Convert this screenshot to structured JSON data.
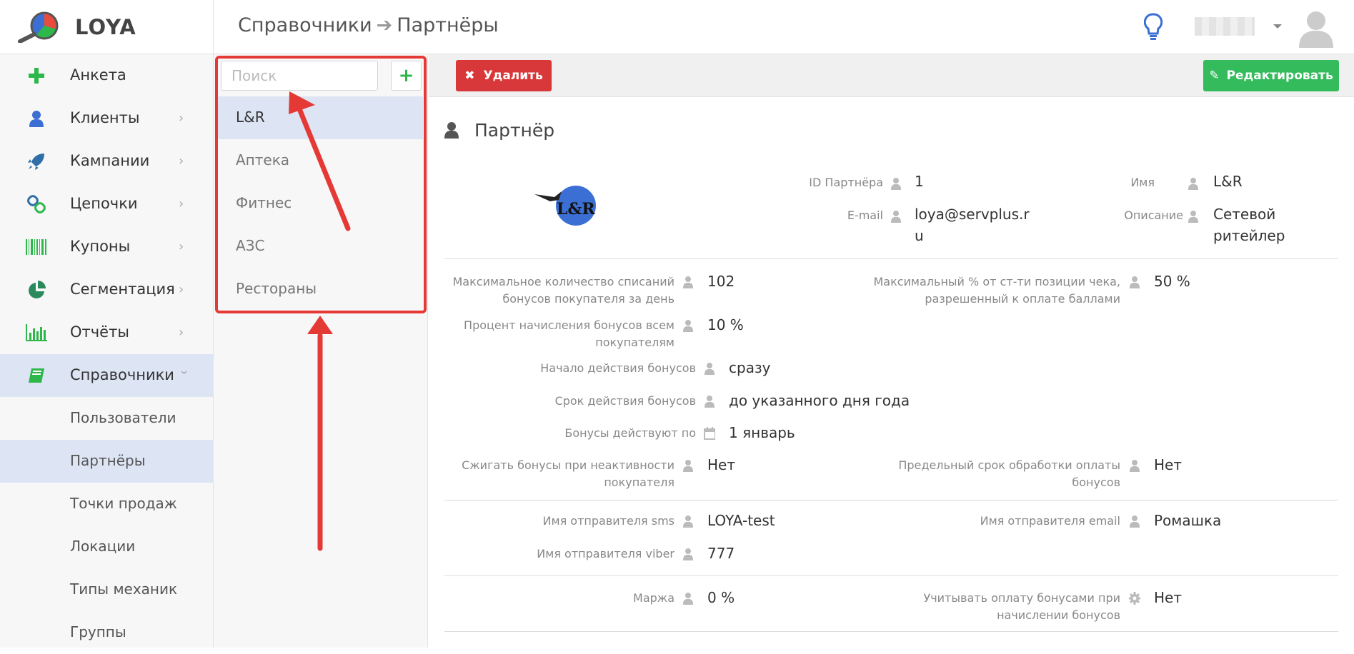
{
  "app": {
    "name": "LOYA"
  },
  "breadcrumb": {
    "parent": "Справочники",
    "arrow": "➔",
    "current": "Партнёры"
  },
  "sidebar": {
    "items": [
      {
        "label": "Анкета",
        "icon": "plus-icon",
        "chevron": ""
      },
      {
        "label": "Клиенты",
        "icon": "user-icon",
        "chevron": "›"
      },
      {
        "label": "Кампании",
        "icon": "rocket-icon",
        "chevron": "›"
      },
      {
        "label": "Цепочки",
        "icon": "chain-icon",
        "chevron": "›"
      },
      {
        "label": "Купоны",
        "icon": "barcode-icon",
        "chevron": "›"
      },
      {
        "label": "Сегментация",
        "icon": "pie-chart-icon",
        "chevron": "›"
      },
      {
        "label": "Отчёты",
        "icon": "bar-chart-icon",
        "chevron": "›"
      },
      {
        "label": "Справочники",
        "icon": "book-icon",
        "chevron": "⌄"
      }
    ],
    "subitems": [
      {
        "label": "Пользователи"
      },
      {
        "label": "Партнёры"
      },
      {
        "label": "Точки продаж"
      },
      {
        "label": "Локации"
      },
      {
        "label": "Типы механик"
      },
      {
        "label": "Группы"
      }
    ]
  },
  "partners_list": {
    "search_placeholder": "Поиск",
    "add_label": "+",
    "items": [
      {
        "label": "L&R"
      },
      {
        "label": "Аптека"
      },
      {
        "label": "Фитнес"
      },
      {
        "label": "АЗС"
      },
      {
        "label": "Рестораны"
      }
    ]
  },
  "toolbar": {
    "delete_label": "Удалить",
    "delete_icon": "✖",
    "edit_label": "Редактировать",
    "edit_icon": "✎"
  },
  "detail": {
    "section_title": "Партнёр",
    "logo_text": "L&R",
    "id_label": "ID Партнёра",
    "id_value": "1",
    "name_label": "Имя",
    "name_value": "L&R",
    "email_label": "E-mail",
    "email_value": "loya@servplus.r u",
    "email_value_l1": "loya@servplus.r",
    "email_value_l2": "u",
    "desc_label": "Описание",
    "desc_value_l1": "Сетевой",
    "desc_value_l2": "ритейлер",
    "max_count_label_l1": "Максимальное количество списаний",
    "max_count_label_l2": "бонусов покупателя за день",
    "max_count_value": "102",
    "max_pct_label_l1": "Максимальный % от ст-ти позиции чека,",
    "max_pct_label_l2": "разрешенный к оплате баллами",
    "max_pct_value": "50 %",
    "accrual_label_l1": "Процент начисления бонусов всем",
    "accrual_label_l2": "покупателям",
    "accrual_value": "10 %",
    "start_label": "Начало действия бонусов",
    "start_value": "сразу",
    "period_label": "Срок действия бонусов",
    "period_value": "до указанного дня года",
    "valid_until_label": "Бонусы действуют по",
    "valid_until_value": "1 январь",
    "burn_label_l1": "Сжигать бонусы при неактивности",
    "burn_label_l2": "покупателя",
    "burn_value": "Нет",
    "limit_label_l1": "Предельный срок обработки оплаты",
    "limit_label_l2": "бонусов",
    "limit_value": "Нет",
    "sms_label": "Имя отправителя sms",
    "sms_value": "LOYA-test",
    "email_sender_label": "Имя отправителя email",
    "email_sender_value": "Ромашка",
    "viber_label": "Имя отправителя viber",
    "viber_value": "777",
    "margin_label": "Маржа",
    "margin_value": "0 %",
    "consider_label_l1": "Учитывать оплату бонусами при",
    "consider_label_l2": "начислении бонусов",
    "consider_value": "Нет"
  },
  "colors": {
    "accent_blue": "#3b6fd4",
    "delete_red": "#d9383a",
    "edit_green": "#33bb5c",
    "highlight": "#dde5f5",
    "annotation_red": "#e53935"
  }
}
